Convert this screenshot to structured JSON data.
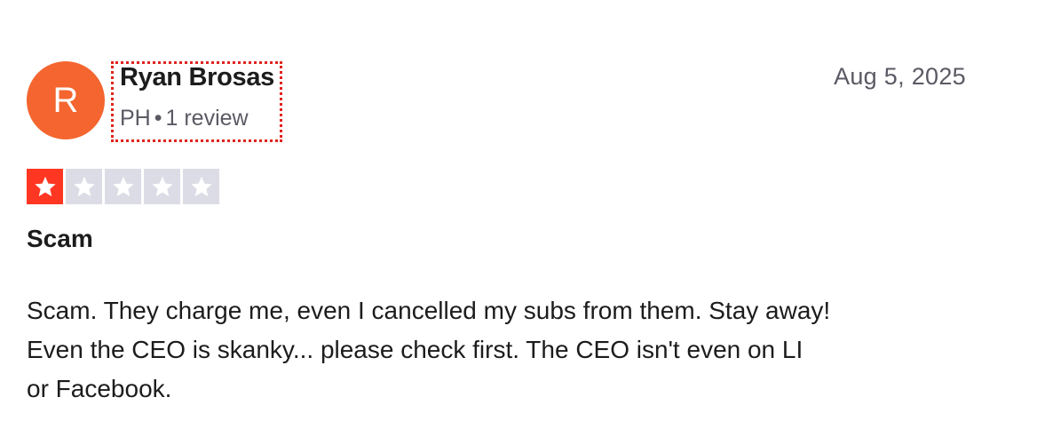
{
  "reviewer": {
    "avatar_initial": "R",
    "name": "Ryan Brosas",
    "country": "PH",
    "separator": "•",
    "review_count": "1 review"
  },
  "review": {
    "date": "Aug 5, 2025",
    "rating": 1,
    "rating_max": 5,
    "title": "Scam",
    "body_lines": [
      "Scam. They charge me, even I cancelled my subs from them. Stay away!",
      "Even the CEO is skanky... please check first. The CEO isn't even on LI",
      "or Facebook."
    ]
  },
  "colors": {
    "avatar_bg": "#f4652f",
    "star_filled": "#ff3722",
    "star_empty": "#dcdce6",
    "highlight_border": "#e0231c"
  },
  "icons": {
    "star": "star-icon"
  }
}
